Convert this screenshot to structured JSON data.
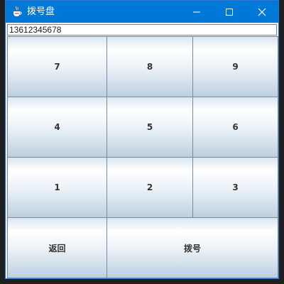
{
  "window": {
    "title": "拨号盘",
    "titlebar_color": "#0078d7",
    "icon": "java-coffee-cup-icon"
  },
  "controls": {
    "minimize_icon": "minimize-icon",
    "maximize_icon": "maximize-icon",
    "close_icon": "close-icon"
  },
  "number_field": {
    "value": "13612345678"
  },
  "keypad": {
    "key_7": "7",
    "key_8": "8",
    "key_9": "9",
    "key_4": "4",
    "key_5": "5",
    "key_6": "6",
    "key_1": "1",
    "key_2": "2",
    "key_3": "3",
    "back": "返回",
    "dial": "拨号"
  }
}
